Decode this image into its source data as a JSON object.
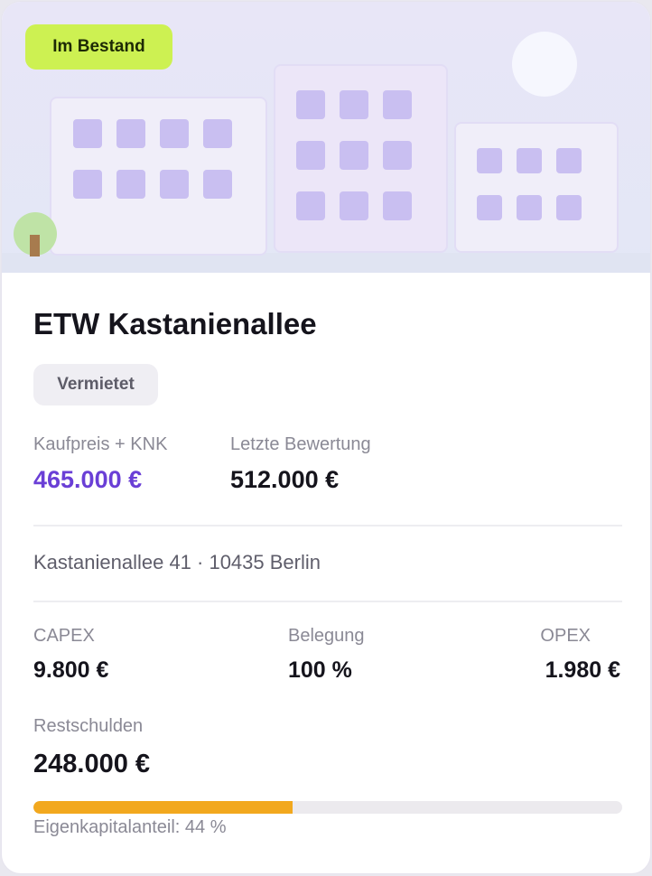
{
  "hero": {
    "badge": "Im Bestand"
  },
  "property": {
    "title": "ETW Kastanienallee",
    "status": "Vermietet",
    "purchase_label": "Kaufpreis + KNK",
    "purchase_value": "465.000 €",
    "valuation_label": "Letzte Bewertung",
    "valuation_value": "512.000 €",
    "address": "Kastanienallee 41 · 10435 Berlin"
  },
  "metrics": {
    "capex_label": "CAPEX",
    "capex_value": "9.800 €",
    "occupancy_label": "Belegung",
    "occupancy_value": "100 %",
    "opex_label": "OPEX",
    "opex_value": "1.980 €",
    "debt_label": "Restschulden",
    "debt_value": "248.000 €"
  },
  "equity": {
    "label": "Eigenkapitalanteil: 44 %",
    "fraction": 0.44
  },
  "colors": {
    "badge_bg": "#cdf152",
    "accent_purple": "#6a3fd6",
    "progress": "#f2a81e"
  }
}
